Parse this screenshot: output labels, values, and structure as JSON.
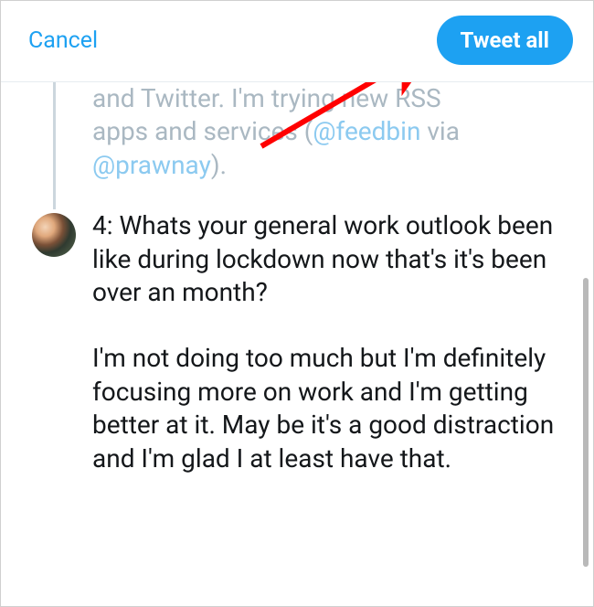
{
  "header": {
    "cancel_label": "Cancel",
    "tweet_all_label": "Tweet all"
  },
  "previous_tweet": {
    "line1_prefix": "and Twitter. I'm trying new RSS",
    "line2_prefix": "apps and services (",
    "mention1": "@feedbin",
    "via": " via ",
    "mention2": "@prawnay",
    "suffix": ")."
  },
  "current_tweet": {
    "paragraph1": "4: Whats your general work outlook been like during lockdown now that's it's been over an month?",
    "paragraph2": "I'm not doing too much but I'm definitely focusing more on work and I'm getting better at it. May be it's a good distraction and I'm glad I at least have that."
  },
  "colors": {
    "twitter_blue": "#1da1f2",
    "muted_text": "#aab8c2",
    "arrow_red": "#ff0000"
  }
}
